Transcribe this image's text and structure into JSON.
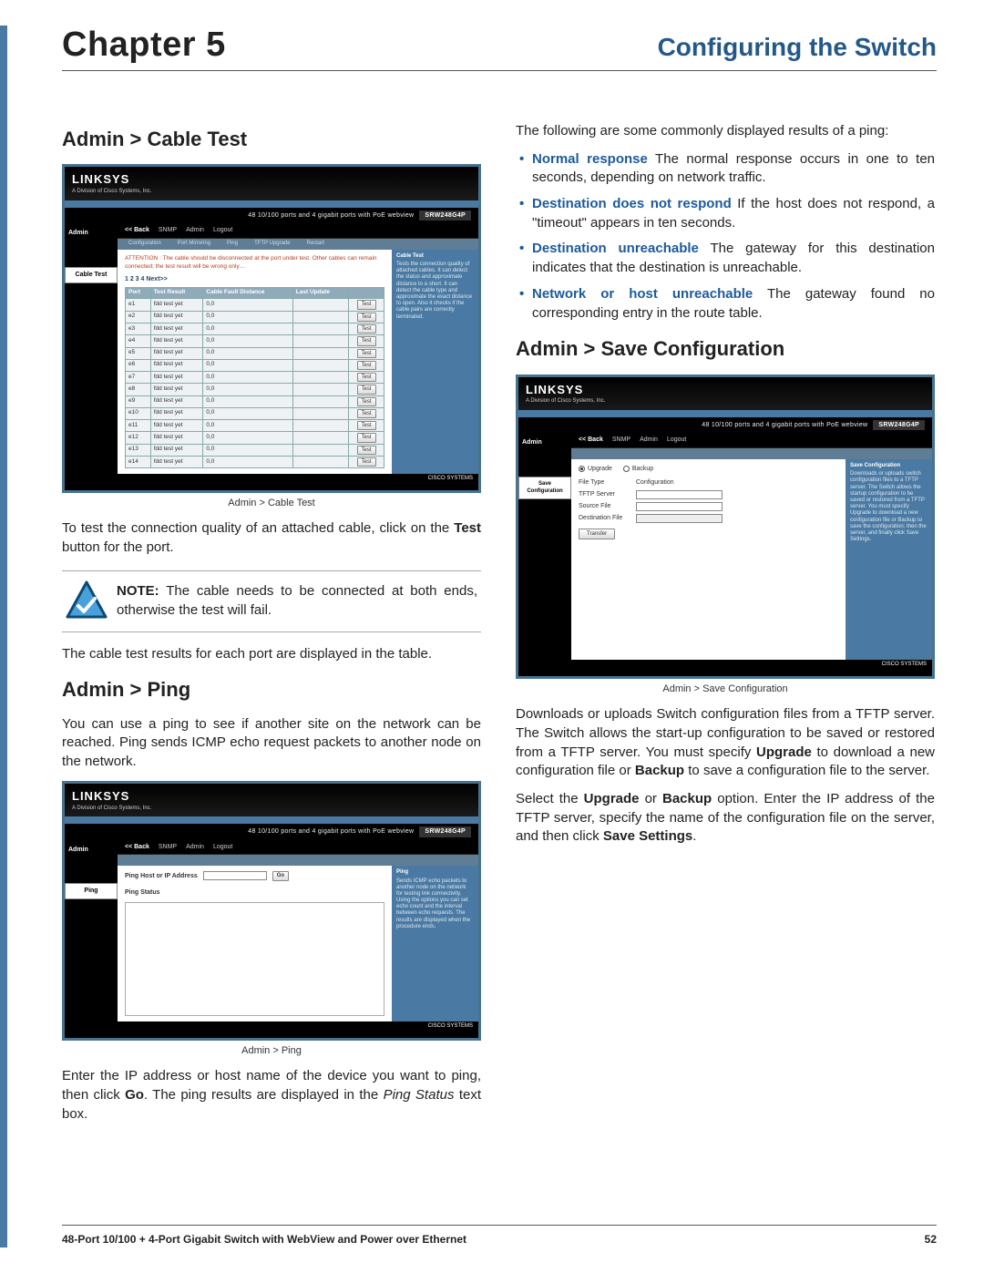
{
  "header": {
    "chapter": "Chapter 5",
    "title": "Configuring the Switch"
  },
  "left": {
    "h_cable": "Admin > Cable Test",
    "cap_cable": "Admin > Cable Test",
    "p_cable_1a": "To test the connection quality of an attached cable, click on the ",
    "p_cable_1b": "Test",
    "p_cable_1c": " button for the port.",
    "note_label": "NOTE:",
    "note_body": " The cable needs to be connected at both ends, otherwise the test will fail.",
    "p_cable_2": "The cable test results for each port are displayed in the table.",
    "h_ping": "Admin > Ping",
    "p_ping_1": "You can use a ping to see if another site on the network can be reached. Ping sends ICMP echo request packets to another node on the network.",
    "cap_ping": "Admin > Ping",
    "p_ping_2a": "Enter the IP address or host name of the device you want to ping, then click ",
    "p_ping_2b": "Go",
    "p_ping_2c": ". The ping results are displayed in the ",
    "p_ping_2d": "Ping Status",
    "p_ping_2e": " text box."
  },
  "right": {
    "intro": "The following are some commonly displayed results of a ping:",
    "bullets": [
      {
        "term": "Normal response",
        "body": "  The normal response occurs in one to ten seconds, depending on network traffic."
      },
      {
        "term": "Destination does not respond",
        "body": "  If the host does not respond, a \"timeout\" appears in ten seconds."
      },
      {
        "term": "Destination unreachable",
        "body": " The gateway for this destination indicates that the destination is unreachable."
      },
      {
        "term": "Network or host unreachable",
        "body": "  The gateway found no corresponding entry in the route table."
      }
    ],
    "h_save": "Admin > Save Configuration",
    "cap_save": "Admin > Save Configuration",
    "p_save_1a": "Downloads or uploads Switch configuration files from a TFTP server. The Switch allows the start-up configuration to be saved or restored from a TFTP server. You must specify ",
    "p_save_1b": "Upgrade",
    "p_save_1c": " to download a new configuration file or ",
    "p_save_1d": "Backup",
    "p_save_1e": " to save a configuration file to the server.",
    "p_save_2a": "Select the ",
    "p_save_2b": "Upgrade",
    "p_save_2c": " or ",
    "p_save_2d": "Backup",
    "p_save_2e": " option. Enter the IP address of the TFTP server, specify the name of the configuration file on the server, and then click ",
    "p_save_2f": "Save Settings",
    "p_save_2g": "."
  },
  "shot": {
    "brand": "LINKSYS",
    "brand_sub": "A Division of Cisco Systems, Inc.",
    "banner": "48 10/100 ports and 4 gigabit ports with PoE webview",
    "model": "SRW248G4P",
    "nav": [
      "<< Back",
      "SNMP",
      "Admin",
      "Logout"
    ],
    "side_admin": "Admin",
    "cable": {
      "tab": "Cable Test",
      "attention": "ATTENTION : The cable should be disconnected at the port under test. Other cables can remain connected; the test result will be wrong only…",
      "subnav": [
        "Configuration",
        "Port Mirroring",
        "Ping",
        "TFTP Upgrade",
        "Restart"
      ],
      "pager": "1  2  3  4   Next>>",
      "cols": [
        "Port",
        "Test Result",
        "Cable Fault Distance",
        "Last Update",
        ""
      ],
      "rows": [
        [
          "e1",
          "fdd test yet",
          "0,0",
          "",
          "Test"
        ],
        [
          "e2",
          "fdd test yet",
          "0,0",
          "",
          "Test"
        ],
        [
          "e3",
          "fdd test yet",
          "0,0",
          "",
          "Test"
        ],
        [
          "e4",
          "fdd test yet",
          "0,0",
          "",
          "Test"
        ],
        [
          "e5",
          "fdd test yet",
          "0,0",
          "",
          "Test"
        ],
        [
          "e6",
          "fdd test yet",
          "0,0",
          "",
          "Test"
        ],
        [
          "e7",
          "fdd test yet",
          "0,0",
          "",
          "Test"
        ],
        [
          "e8",
          "fdd test yet",
          "0,0",
          "",
          "Test"
        ],
        [
          "e9",
          "fdd test yet",
          "0,0",
          "",
          "Test"
        ],
        [
          "e10",
          "fdd test yet",
          "0,0",
          "",
          "Test"
        ],
        [
          "e11",
          "fdd test yet",
          "0,0",
          "",
          "Test"
        ],
        [
          "e12",
          "fdd test yet",
          "0,0",
          "",
          "Test"
        ],
        [
          "e13",
          "fdd test yet",
          "0,0",
          "",
          "Test"
        ],
        [
          "e14",
          "fdd test yet",
          "0,0",
          "",
          "Test"
        ]
      ],
      "help_title": "Cable Test",
      "help_body": "Tests the connection quality of attached cables. It can detect the status and approximate distance to a short. It can detect the cable type and approximate the exact distance to open. Also it checks if the cable pairs are correctly terminated."
    },
    "ping": {
      "tab": "Ping",
      "label": "Ping Host or IP Address",
      "go": "Go",
      "status_label": "Ping Status",
      "help_title": "Ping",
      "help_body": "Sends ICMP echo packets to another node on the network for testing link connectivity. Using the options you can set echo count and the interval between echo requests. The results are displayed when the procedure ends."
    },
    "save": {
      "tab": "Save Configuration",
      "opt_upgrade": "Upgrade",
      "opt_backup": "Backup",
      "f_type": "File Type",
      "f_type_val": "Configuration",
      "f_server": "TFTP Server",
      "f_src": "Source File",
      "f_dst": "Destination File",
      "btn": "Transfer",
      "help_title": "Save Configuration",
      "help_body": "Downloads or uploads switch configuration files to a TFTP server. The Switch allows the startup configuration to be saved or restored from a TFTP server. You must specify Upgrade to download a new configuration file or Backup to save the configuration; then the server, and finally click Save Settings."
    },
    "cisco": "CISCO SYSTEMS"
  },
  "footer": {
    "left": "48-Port 10/100 + 4-Port Gigabit Switch with WebView and Power over Ethernet",
    "right": "52"
  }
}
